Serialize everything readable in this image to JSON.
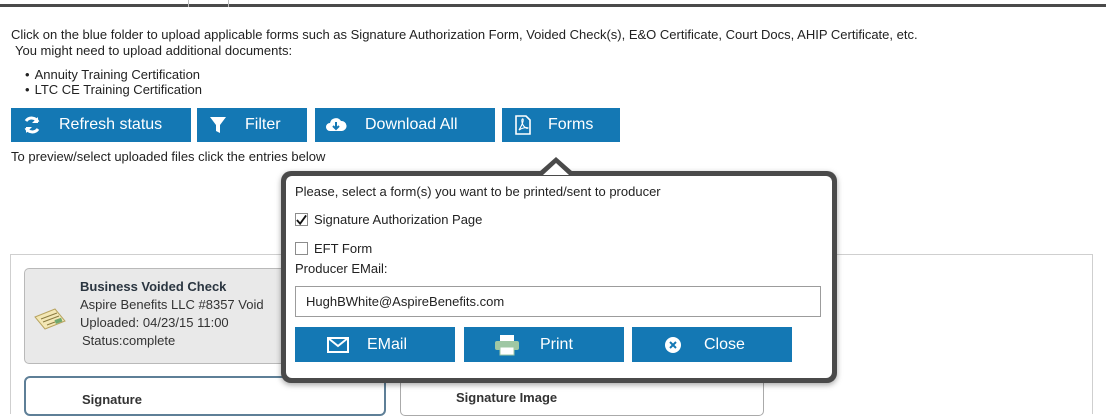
{
  "instructions": {
    "line1": "Click on the blue folder to upload applicable forms such as Signature Authorization Form, Voided Check(s), E&O Certificate, Court Docs, AHIP Certificate, etc.",
    "line2": "You might need to upload additional documents:",
    "bullets": [
      "Annuity Training Certification",
      "LTC CE Training Certification"
    ]
  },
  "toolbar": {
    "refresh_label": "Refresh status",
    "filter_label": "Filter",
    "download_label": "Download All",
    "forms_label": "Forms"
  },
  "hint": "To preview/select uploaded files click the entries below",
  "files": [
    {
      "title": "Business Voided Check",
      "name": "Aspire Benefits LLC #8357 Void",
      "uploaded": "Uploaded: 04/23/15 11:00",
      "status": "Status:complete"
    },
    {
      "title": "Signature"
    },
    {
      "title": "Signature Image"
    }
  ],
  "forms_popover": {
    "prompt": "Please, select a form(s) you want to be printed/sent to producer",
    "options": [
      {
        "label": "Signature Authorization Page",
        "checked": true
      },
      {
        "label": "EFT Form",
        "checked": false
      }
    ],
    "email_label": "Producer EMail:",
    "email_value": "HughBWhite@AspireBenefits.com",
    "email_button": "EMail",
    "print_button": "Print",
    "close_button": "Close"
  },
  "colors": {
    "accent": "#1478b4",
    "popover_border": "#4a4a4a"
  },
  "icons": {
    "refresh": "refresh-icon",
    "filter": "filter-icon",
    "download": "cloud-download-icon",
    "forms": "pdf-icon",
    "email": "envelope-icon",
    "print": "printer-icon",
    "close": "close-circle-icon",
    "file": "check-document-icon"
  }
}
